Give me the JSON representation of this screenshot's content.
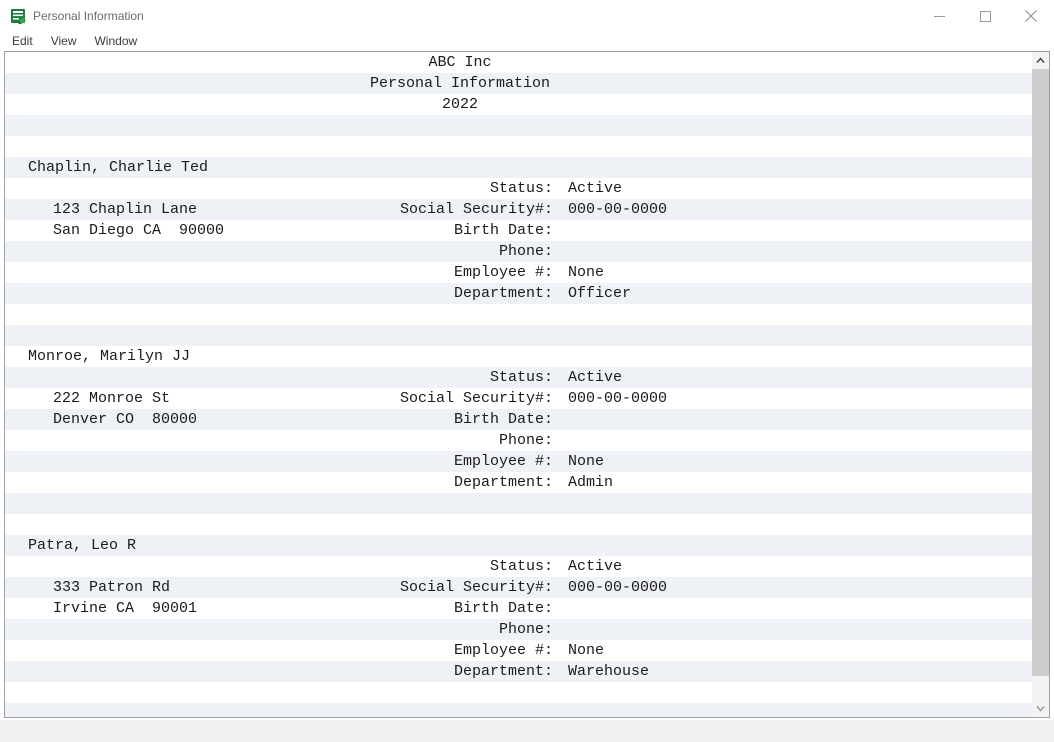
{
  "window": {
    "title": "Personal Information",
    "icon": "report-document-icon",
    "controls": {
      "minimize": "minimize-icon",
      "maximize": "maximize-icon",
      "close": "close-icon"
    }
  },
  "menubar": {
    "items": [
      {
        "label": "Edit"
      },
      {
        "label": "View"
      },
      {
        "label": "Window"
      }
    ]
  },
  "report": {
    "header": {
      "company": "ABC Inc",
      "report_title": "Personal Information",
      "year": "2022"
    },
    "labels": {
      "status": "Status:",
      "ssn": "Social Security#:",
      "birth_date": "Birth Date:",
      "phone": "Phone:",
      "employee_number": "Employee #:",
      "department": "Department:"
    },
    "records": [
      {
        "name": "Chaplin, Charlie Ted",
        "address1": "123 Chaplin Lane",
        "address2": "San Diego CA  90000",
        "status": "Active",
        "ssn": "000-00-0000",
        "birth_date": "",
        "phone": "",
        "employee_number": "None",
        "department": "Officer"
      },
      {
        "name": "Monroe, Marilyn JJ",
        "address1": "222 Monroe St",
        "address2": "Denver CO  80000",
        "status": "Active",
        "ssn": "000-00-0000",
        "birth_date": "",
        "phone": "",
        "employee_number": "None",
        "department": "Admin"
      },
      {
        "name": "Patra, Leo R",
        "address1": "333 Patron Rd",
        "address2": "Irvine CA  90001",
        "status": "Active",
        "ssn": "000-00-0000",
        "birth_date": "",
        "phone": "",
        "employee_number": "None",
        "department": "Warehouse"
      }
    ]
  },
  "scrollbar": {
    "up_arrow": "chevron-up-icon",
    "down_arrow": "chevron-down-icon"
  },
  "colors": {
    "stripe": "#eef1f5",
    "text": "#1b1b1b",
    "border": "#a0a0a0",
    "thumb": "#cdcdcd"
  }
}
